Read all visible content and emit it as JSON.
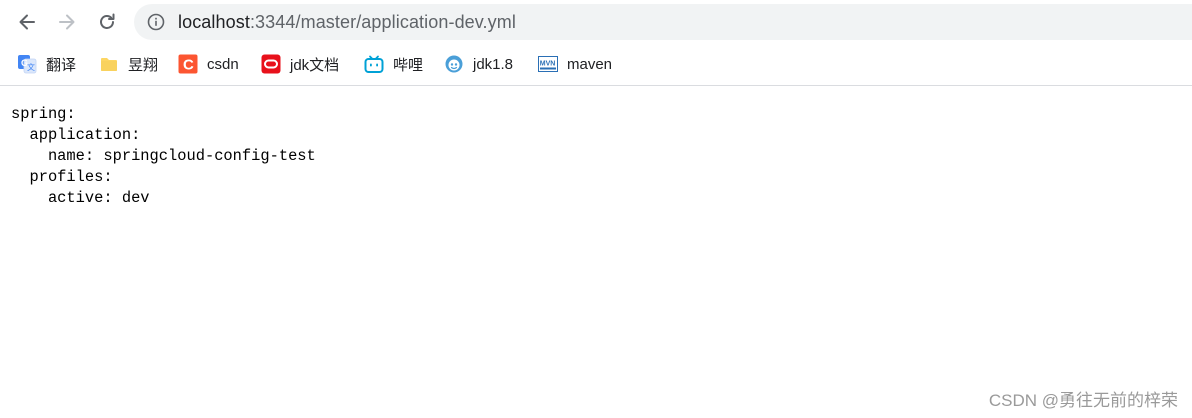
{
  "browser": {
    "url_host": "localhost",
    "url_rest": ":3344/master/application-dev.yml"
  },
  "bookmarks": [
    {
      "label": "翻译",
      "icon": "google-translate-icon"
    },
    {
      "label": "昱翔",
      "icon": "folder-icon"
    },
    {
      "label": "csdn",
      "icon": "csdn-icon"
    },
    {
      "label": "jdk文档",
      "icon": "oracle-icon"
    },
    {
      "label": "哔哩",
      "icon": "bilibili-icon"
    },
    {
      "label": "jdk1.8",
      "icon": "jdk-icon"
    },
    {
      "label": "maven",
      "icon": "maven-icon"
    }
  ],
  "document": {
    "yaml_text": "spring:\n  application:\n    name: springcloud-config-test\n  profiles:\n    active: dev"
  },
  "watermark": "CSDN @勇往无前的梓荣",
  "colors": {
    "omnibox_bg": "#f1f3f4",
    "csdn_brand": "#fc5531",
    "oracle_red": "#e8111b",
    "bilibili_blue": "#00a1d6",
    "jdk_blue": "#4a9fd8",
    "maven_blue": "#2a6fb5"
  }
}
